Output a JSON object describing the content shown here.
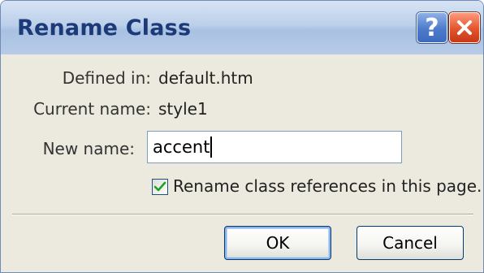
{
  "window": {
    "title": "Rename Class",
    "help_label": "?",
    "close_label": "×"
  },
  "fields": {
    "defined_in_label": "Defined in:",
    "defined_in_value": "default.htm",
    "current_name_label": "Current name:",
    "current_name_value": "style1",
    "new_name_label": "New name:",
    "new_name_value": "accent"
  },
  "options": {
    "rename_refs_label": "Rename class references in this page.",
    "rename_refs_checked": true
  },
  "buttons": {
    "ok_label": "OK",
    "cancel_label": "Cancel"
  },
  "colors": {
    "title_text": "#1c3a78",
    "check_mark": "#21a121",
    "close_button": "#e2542c",
    "help_button": "#4c7bcc"
  }
}
